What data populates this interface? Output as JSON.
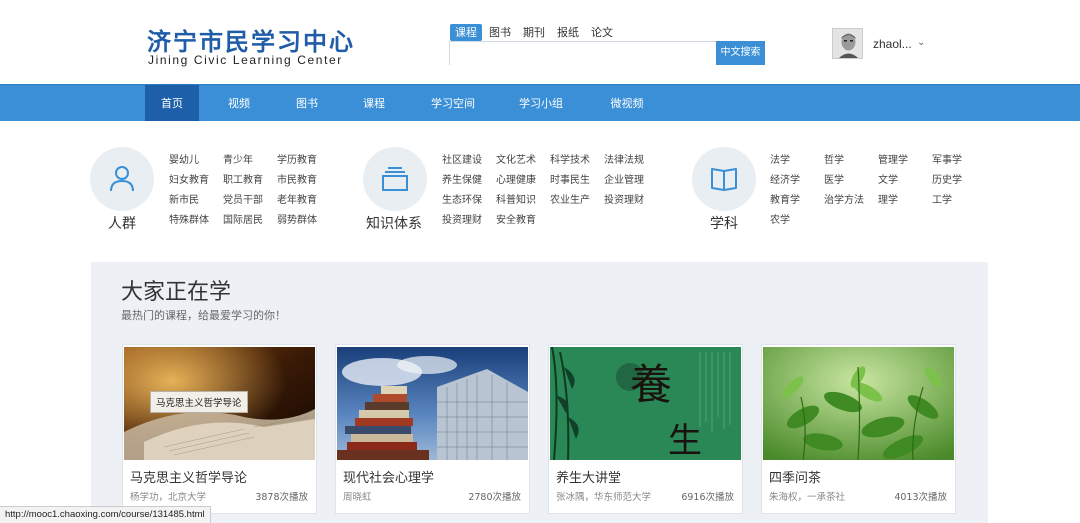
{
  "header": {
    "logo_cn": "济宁市民学习中心",
    "logo_en": "Jining Civic Learning Center",
    "search_tabs": [
      "课程",
      "图书",
      "期刊",
      "报纸",
      "论文"
    ],
    "search_placeholder": "",
    "search_button": "中文搜索",
    "username": "zhaol...",
    "user_arrow": "⌄"
  },
  "nav": {
    "items": [
      "首页",
      "视频",
      "图书",
      "课程",
      "学习空间",
      "学习小组",
      "微视频"
    ],
    "active": "首页"
  },
  "categories": {
    "crowd": {
      "label": "人群",
      "icon": "person-icon",
      "links": [
        "婴幼儿",
        "青少年",
        "学历教育",
        "妇女教育",
        "职工教育",
        "市民教育",
        "新市民",
        "党员干部",
        "老年教育",
        "特殊群体",
        "国际居民",
        "弱势群体"
      ]
    },
    "knowledge": {
      "label": "知识体系",
      "icon": "layers-icon",
      "links": [
        "社区建设",
        "文化艺术",
        "科学技术",
        "法律法规",
        "养生保健",
        "心理健康",
        "时事民生",
        "企业管理",
        "生态环保",
        "科普知识",
        "农业生产",
        "投资理财",
        "投资理财",
        "安全教育"
      ]
    },
    "subject": {
      "label": "学科",
      "icon": "book-icon",
      "links": [
        "法学",
        "哲学",
        "管理学",
        "军事学",
        "经济学",
        "医学",
        "文学",
        "历史学",
        "教育学",
        "治学方法",
        "理学",
        "工学",
        "农学"
      ]
    }
  },
  "trending": {
    "title": "大家正在学",
    "subtitle": "最热门的课程，给最爱学习的你！",
    "courses": [
      {
        "title": "马克思主义哲学导论",
        "meta": "杨学功，北京大学",
        "plays": "3878次播放",
        "image_caption": "马克思主义哲学导论"
      },
      {
        "title": "现代社会心理学",
        "meta": "周晓虹",
        "plays": "2780次播放"
      },
      {
        "title": "养生大讲堂",
        "meta": "张冰隅，华东师范大学",
        "plays": "6916次播放",
        "image_chars": [
          "養",
          "生"
        ]
      },
      {
        "title": "四季问茶",
        "meta": "朱海权，一承茶社",
        "plays": "4013次播放"
      }
    ]
  },
  "status_bar": "http://mooc1.chaoxing.com/course/131485.html",
  "colors": {
    "brand_blue": "#3a8fd6",
    "nav_active": "#1d5fa8",
    "logo_blue": "#1f5da8",
    "panel_bg": "#edf1f5"
  }
}
